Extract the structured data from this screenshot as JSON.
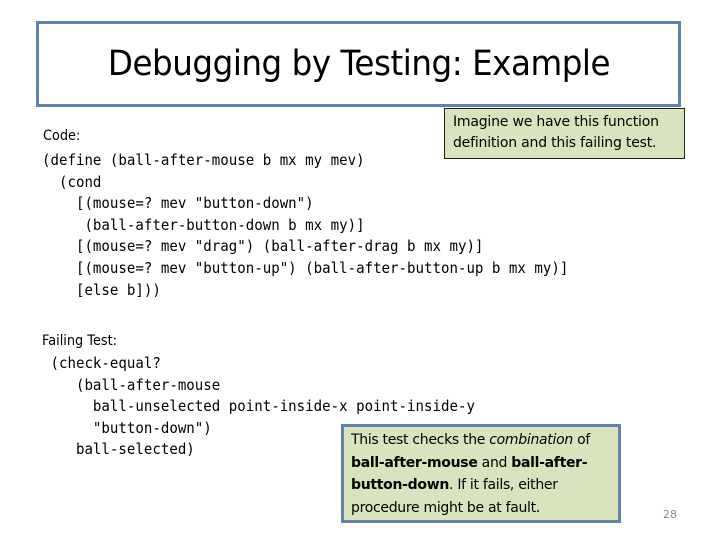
{
  "slide": {
    "title": "Debugging by Testing: Example",
    "page_number": "28"
  },
  "code_section": {
    "label": "Code:",
    "lines": [
      "(define (ball-after-mouse b mx my mev)",
      "  (cond",
      "    [(mouse=? mev \"button-down\")",
      "     (ball-after-button-down b mx my)]",
      "    [(mouse=? mev \"drag\") (ball-after-drag b mx my)]",
      "    [(mouse=? mev \"button-up\") (ball-after-button-up b mx my)]",
      "    [else b]))"
    ]
  },
  "test_section": {
    "label": "Failing Test:",
    "lines": [
      " (check-equal?",
      "    (ball-after-mouse",
      "      ball-unselected point-inside-x point-inside-y",
      "      \"button-down\")",
      "    ball-selected)"
    ]
  },
  "callouts": {
    "top": {
      "line1": "Imagine we have this function",
      "line2": "definition and this failing test."
    },
    "bottom": {
      "t1": "This test checks the ",
      "t2_italic": "combination",
      "t3": " of",
      "t4_bold": "ball-after-mouse",
      "t5": " and ",
      "t6_bold": "ball-after-",
      "t7_bold": "button-down",
      "t8": ".  If it fails, either",
      "t9": "procedure might be at fault."
    }
  },
  "colors": {
    "title_border": "#6083ab",
    "callout_fill": "#d7e4bd",
    "callout_border": "#6083ab"
  }
}
